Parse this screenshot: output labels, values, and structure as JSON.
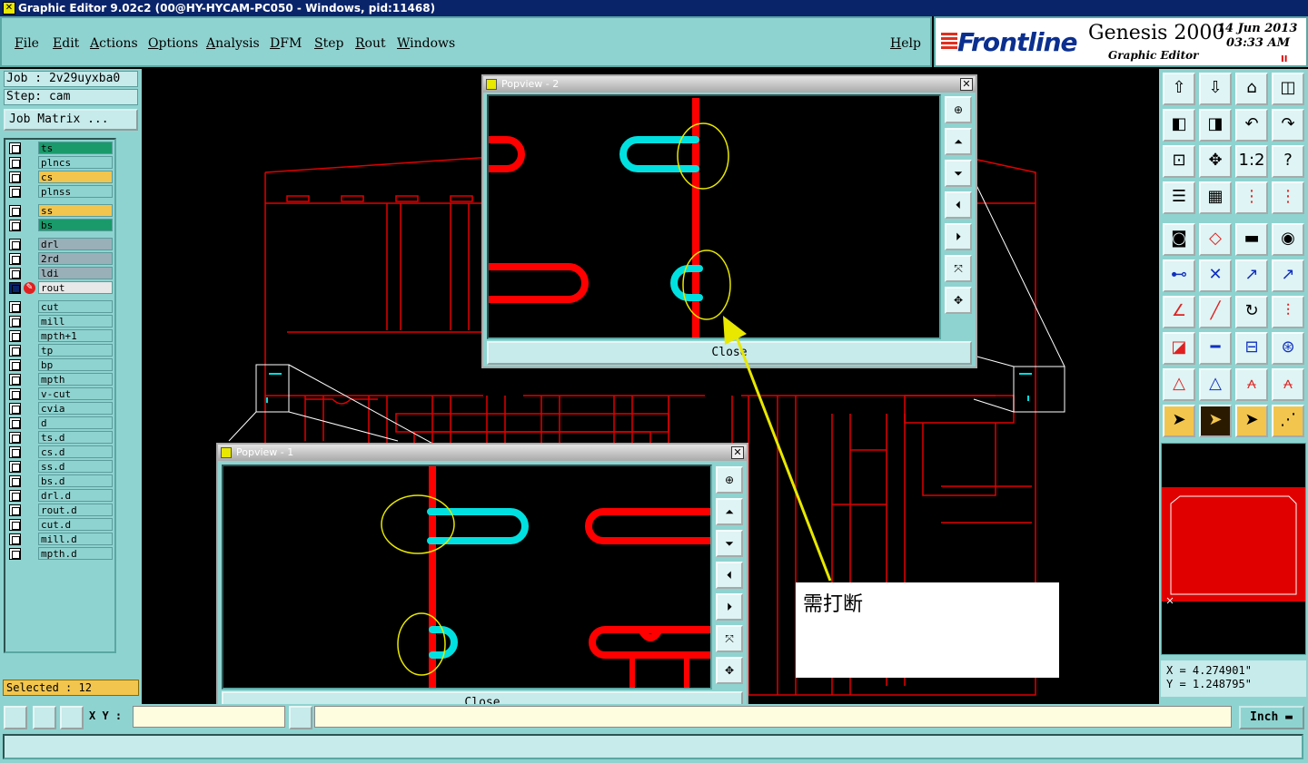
{
  "window": {
    "title": "Graphic Editor 9.02c2 (00@HY-HYCAM-PC050 - Windows, pid:11468)"
  },
  "menu": {
    "items": [
      "File",
      "Edit",
      "Actions",
      "Options",
      "Analysis",
      "DFM",
      "Step",
      "Rout",
      "Windows"
    ],
    "help": "Help"
  },
  "brand": {
    "logo": "Frontline",
    "product": "Genesis 2000",
    "subtitle": "Graphic Editor",
    "date": "14 Jun 2013",
    "time": "03:33 AM",
    "pause_symbol": "II"
  },
  "job": {
    "job_label": "Job : 2v29uyxba0",
    "step_label": "Step: cam",
    "matrix_button": "Job Matrix ..."
  },
  "layers": [
    {
      "name": "ts",
      "color": "#1a9a6a"
    },
    {
      "name": "plncs",
      "color": "#8fd3d0"
    },
    {
      "name": "cs",
      "color": "#f2c54e"
    },
    {
      "name": "plnss",
      "color": "#8fd3d0"
    },
    {
      "name": "ss",
      "color": "#f2c54e"
    },
    {
      "name": "bs",
      "color": "#1a9a6a"
    },
    {
      "name": "drl",
      "color": "#9ab0b8"
    },
    {
      "name": "2rd",
      "color": "#9ab0b8"
    },
    {
      "name": "ldi",
      "color": "#9ab0b8"
    },
    {
      "name": "rout",
      "color": "#e8e8e8"
    },
    {
      "name": "cut",
      "color": "#8fd3d0"
    },
    {
      "name": "mill",
      "color": "#8fd3d0"
    },
    {
      "name": "mpth+1",
      "color": "#8fd3d0"
    },
    {
      "name": "tp",
      "color": "#8fd3d0"
    },
    {
      "name": "bp",
      "color": "#8fd3d0"
    },
    {
      "name": "mpth",
      "color": "#8fd3d0"
    },
    {
      "name": "v-cut",
      "color": "#8fd3d0"
    },
    {
      "name": "cvia",
      "color": "#8fd3d0"
    },
    {
      "name": "d",
      "color": "#8fd3d0"
    },
    {
      "name": "ts.d",
      "color": "#8fd3d0"
    },
    {
      "name": "cs.d",
      "color": "#8fd3d0"
    },
    {
      "name": "ss.d",
      "color": "#8fd3d0"
    },
    {
      "name": "bs.d",
      "color": "#8fd3d0"
    },
    {
      "name": "drl.d",
      "color": "#8fd3d0"
    },
    {
      "name": "rout.d",
      "color": "#8fd3d0"
    },
    {
      "name": "cut.d",
      "color": "#8fd3d0"
    },
    {
      "name": "mill.d",
      "color": "#8fd3d0"
    },
    {
      "name": "mpth.d",
      "color": "#8fd3d0"
    }
  ],
  "selection": {
    "label": "Selected : 12"
  },
  "bottom": {
    "xy_label": "X Y :",
    "unit": "Inch"
  },
  "coords": {
    "x": "X = 4.274901\"",
    "y": "Y = 1.248795\""
  },
  "popview1": {
    "title": "Popview - 1",
    "close_label": "Close"
  },
  "popview2": {
    "title": "Popview - 2",
    "close_label": "Close"
  },
  "note": {
    "text": "需打断"
  },
  "colors": {
    "outline": "#e00000",
    "highlight": "#00e0e0",
    "annotation": "#e8e800"
  }
}
